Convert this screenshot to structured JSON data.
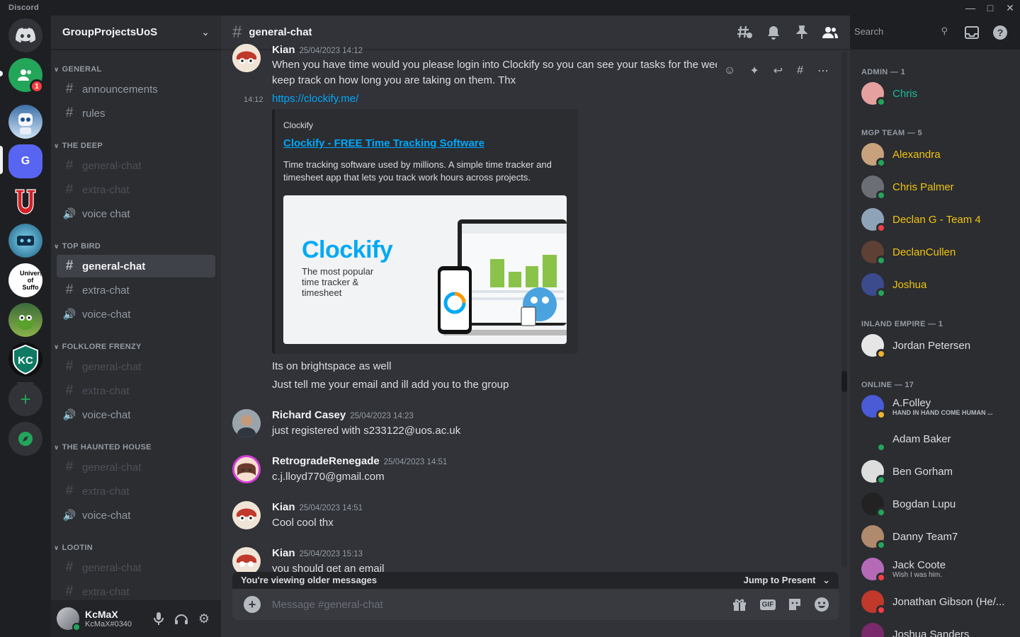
{
  "app": {
    "title": "Discord"
  },
  "servers": {
    "badge_count": "1",
    "items": [
      {
        "name": "home",
        "label": ""
      },
      {
        "name": "friends-server",
        "label": ""
      },
      {
        "name": "robot-server",
        "label": ""
      },
      {
        "name": "g-server",
        "label": "G"
      },
      {
        "name": "u-server",
        "label": "U"
      },
      {
        "name": "game-server",
        "label": ""
      },
      {
        "name": "university-server",
        "label": "Univers of Suffo"
      },
      {
        "name": "kermit-server",
        "label": ""
      },
      {
        "name": "kc-server",
        "label": "KC"
      }
    ]
  },
  "sidebar": {
    "guild_name": "GroupProjectsUoS",
    "categories": [
      {
        "name": "GENERAL",
        "channels": [
          {
            "name": "announcements",
            "type": "text",
            "state": "normal"
          },
          {
            "name": "rules",
            "type": "text",
            "state": "normal"
          }
        ]
      },
      {
        "name": "THE DEEP",
        "channels": [
          {
            "name": "general-chat",
            "type": "text",
            "state": "muted"
          },
          {
            "name": "extra-chat",
            "type": "text",
            "state": "muted"
          },
          {
            "name": "voice chat",
            "type": "voice",
            "state": "normal"
          }
        ]
      },
      {
        "name": "TOP BIRD",
        "channels": [
          {
            "name": "general-chat",
            "type": "text",
            "state": "active"
          },
          {
            "name": "extra-chat",
            "type": "text",
            "state": "normal"
          },
          {
            "name": "voice-chat",
            "type": "voice",
            "state": "normal"
          }
        ]
      },
      {
        "name": "FOLKLORE FRENZY",
        "channels": [
          {
            "name": "general-chat",
            "type": "text",
            "state": "muted"
          },
          {
            "name": "extra-chat",
            "type": "text",
            "state": "muted"
          },
          {
            "name": "voice-chat",
            "type": "voice",
            "state": "normal"
          }
        ]
      },
      {
        "name": "THE HAUNTED HOUSE",
        "channels": [
          {
            "name": "general-chat",
            "type": "text",
            "state": "muted"
          },
          {
            "name": "extra-chat",
            "type": "text",
            "state": "muted"
          },
          {
            "name": "voice-chat",
            "type": "voice",
            "state": "normal"
          }
        ]
      },
      {
        "name": "LOOTIN",
        "channels": [
          {
            "name": "general-chat",
            "type": "text",
            "state": "muted"
          },
          {
            "name": "extra-chat",
            "type": "text",
            "state": "muted"
          }
        ]
      }
    ],
    "user": {
      "name": "KcMaX",
      "tag": "KcMaX#0340"
    }
  },
  "chat": {
    "channel_name": "general-chat",
    "search_placeholder": "Search",
    "messages": [
      {
        "author": "Kian",
        "time": "25/04/2023 14:12",
        "lines": [
          "When you have time would you please login into Clockify so you can see your tasks for the week and also to",
          "keep track on how long you are taking on them. Thx"
        ]
      },
      {
        "short_time": "14:12",
        "link": "https://clockify.me/"
      },
      {
        "text": "Its on brightspace as well"
      },
      {
        "text": "Just tell me your email and ill add you to the group"
      },
      {
        "author": "Richard Casey",
        "time": "25/04/2023 14:23",
        "text": "just registered with s233122@uos.ac.uk"
      },
      {
        "author": "RetrogradeRenegade",
        "time": "25/04/2023 14:51",
        "text": "c.j.lloyd770@gmail.com"
      },
      {
        "author": "Kian",
        "time": "25/04/2023 14:51",
        "text": "Cool cool thx"
      },
      {
        "author": "Kian",
        "time": "25/04/2023 15:13",
        "text": "you should get an email"
      }
    ],
    "embed": {
      "provider": "Clockify",
      "title": "Clockify - FREE Time Tracking Software",
      "description": "Time tracking software used by millions. A simple time tracker and timesheet app that lets you track work hours across projects.",
      "image_logo": "Clockify",
      "image_tagline": "The most popular time tracker & timesheet"
    },
    "older_notice": "You're viewing older messages",
    "jump_label": "Jump to Present",
    "composer_placeholder": "Message #general-chat",
    "gif_label": "GIF"
  },
  "members": {
    "groups": [
      {
        "title": "ADMIN — 1",
        "members": [
          {
            "name": "Chris",
            "color": "#1abc9c",
            "status": "online"
          }
        ]
      },
      {
        "title": "MGP TEAM — 5",
        "members": [
          {
            "name": "Alexandra",
            "color": "#f1c40f",
            "status": "online"
          },
          {
            "name": "Chris Palmer",
            "color": "#f1c40f",
            "status": "online"
          },
          {
            "name": "Declan G - Team 4",
            "color": "#f1c40f",
            "status": "dnd"
          },
          {
            "name": "DeclanCullen",
            "color": "#f1c40f",
            "status": "online"
          },
          {
            "name": "Joshua",
            "color": "#f1c40f",
            "status": "online"
          }
        ]
      },
      {
        "title": "INLAND EMPIRE — 1",
        "members": [
          {
            "name": "Jordan Petersen",
            "color": "#dbdee1",
            "status": "idle"
          }
        ]
      },
      {
        "title": "ONLINE — 17",
        "members": [
          {
            "name": "A.Folley",
            "color": "#dbdee1",
            "status": "idle",
            "sub": "HAND IN HAND COME HUMAN ..."
          },
          {
            "name": "Adam Baker",
            "color": "#dbdee1",
            "status": "online"
          },
          {
            "name": "Ben Gorham",
            "color": "#dbdee1",
            "status": "online"
          },
          {
            "name": "Bogdan Lupu",
            "color": "#dbdee1",
            "status": "online"
          },
          {
            "name": "Danny Team7",
            "color": "#dbdee1",
            "status": "online"
          },
          {
            "name": "Jack Coote",
            "color": "#dbdee1",
            "status": "dnd",
            "sub": "Wish I was him."
          },
          {
            "name": "Jonathan Gibson (He/...",
            "color": "#dbdee1",
            "status": "dnd"
          },
          {
            "name": "Joshua Sanders",
            "color": "#dbdee1",
            "status": "online"
          }
        ]
      }
    ]
  }
}
